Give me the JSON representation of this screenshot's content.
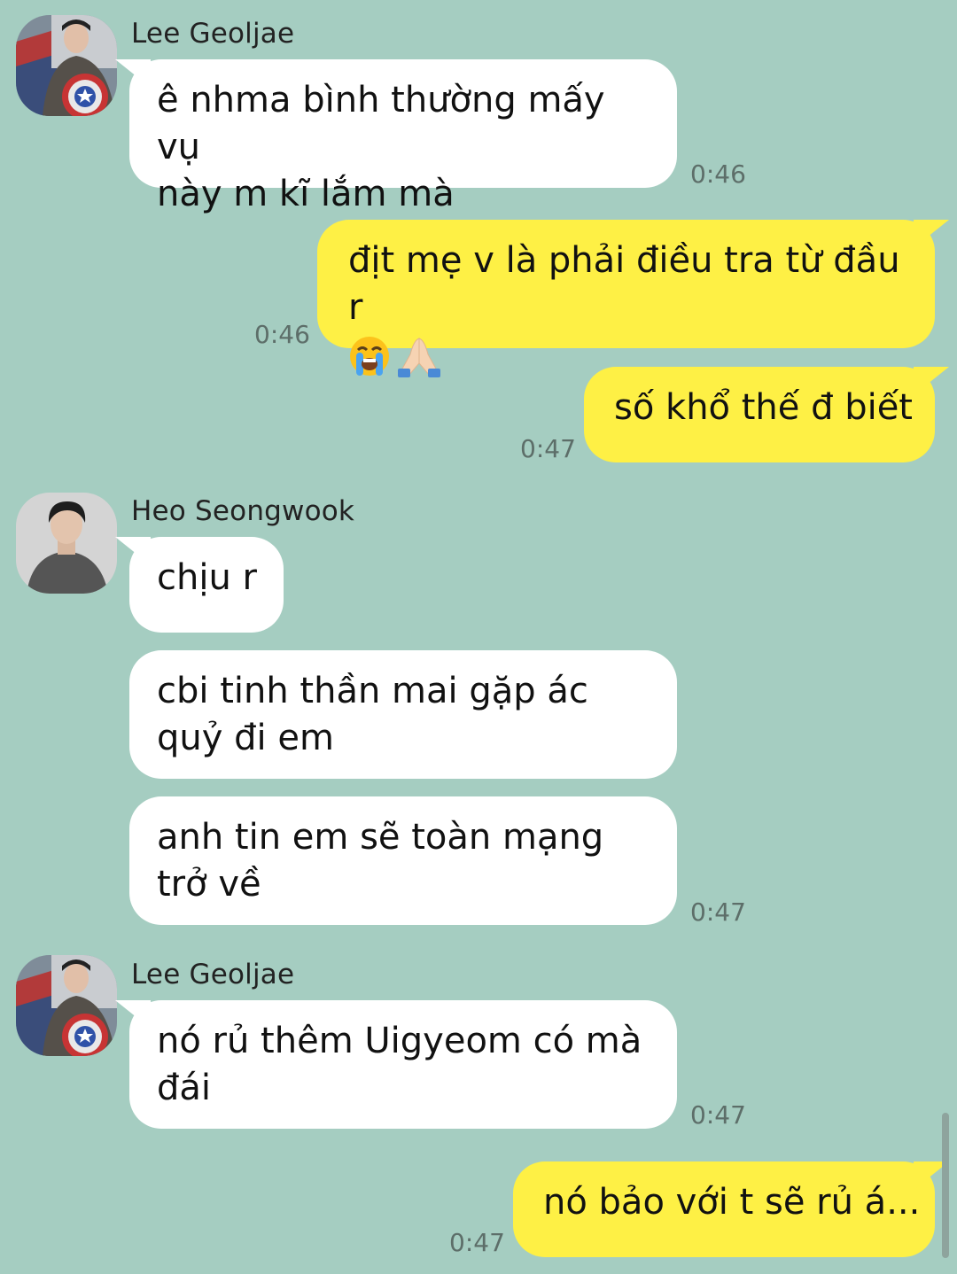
{
  "senders": {
    "lee": "Lee Geoljae",
    "heo": "Heo Seongwook"
  },
  "messages": {
    "m1": {
      "line1": "ê nhma bình thường mấy vụ",
      "line2": "này m kĩ lắm mà",
      "time": "0:46"
    },
    "m2": {
      "line1": "địt mẹ v là phải điều tra từ đầu r",
      "emojis": [
        "loudly-crying-face-emoji",
        "folded-hands-emoji"
      ],
      "time": "0:46"
    },
    "m3": {
      "text": "số khổ thế đ biết",
      "time": "0:47"
    },
    "m4": {
      "text": "chịu r"
    },
    "m5": {
      "line1": "cbi tinh thần mai gặp ác",
      "line2": "quỷ đi em"
    },
    "m6": {
      "line1": "anh tin em sẽ toàn mạng",
      "line2": "trở về",
      "time": "0:47"
    },
    "m7": {
      "line1": "nó rủ thêm Uigyeom có mà",
      "line2": "đái",
      "time": "0:47"
    },
    "m8": {
      "text": "nó bảo với t sẽ rủ á...",
      "time": "0:47"
    }
  },
  "colors": {
    "background": "#a5cdc1",
    "incoming_bubble": "#ffffff",
    "outgoing_bubble": "#fef045",
    "timestamp": "#5d6e69"
  }
}
